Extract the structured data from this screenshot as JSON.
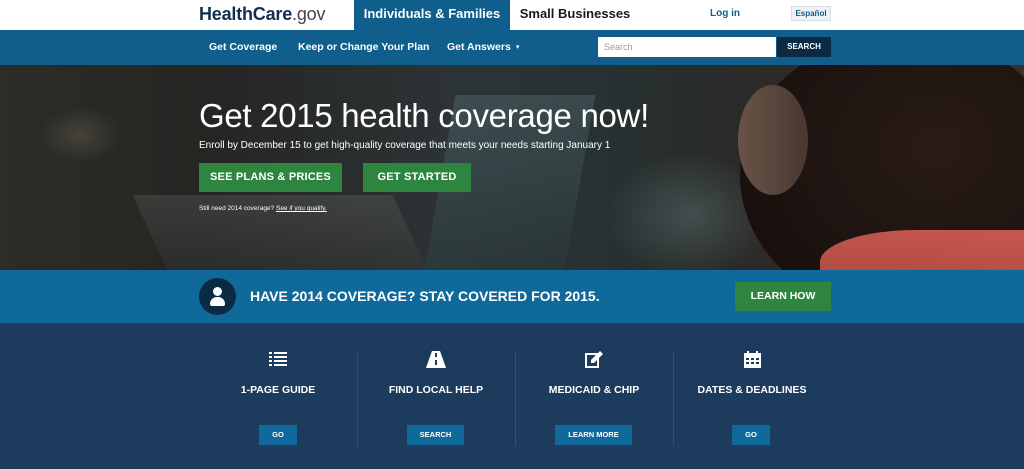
{
  "header": {
    "logo_brand": "HealthCare",
    "logo_suffix": ".gov",
    "tab_individuals": "Individuals & Families",
    "tab_small_business": "Small Businesses",
    "login": "Log in",
    "language": "Español"
  },
  "nav": {
    "items": [
      {
        "label": "Get Coverage"
      },
      {
        "label": "Keep or Change Your Plan"
      },
      {
        "label": "Get Answers",
        "caret": "▾"
      }
    ],
    "search_placeholder": "Search",
    "search_button": "SEARCH"
  },
  "hero": {
    "title": "Get 2015 health coverage now!",
    "subtitle": "Enroll by December 15 to get high-quality coverage that meets your needs starting January 1",
    "primary_button": "SEE PLANS & PRICES",
    "secondary_button": "GET STARTED",
    "note_text": "Still need 2014 coverage?",
    "note_link": "See if you qualify."
  },
  "band": {
    "icon": "person-icon",
    "text": "HAVE 2014 COVERAGE? STAY COVERED FOR 2015.",
    "button": "LEARN HOW"
  },
  "features": [
    {
      "icon": "list-icon",
      "title": "1-PAGE GUIDE",
      "button": "GO"
    },
    {
      "icon": "road-icon",
      "title": "FIND LOCAL HELP",
      "button": "SEARCH"
    },
    {
      "icon": "edit-icon",
      "title": "MEDICAID & CHIP",
      "button": "LEARN MORE"
    },
    {
      "icon": "calendar-icon",
      "title": "DATES & DEADLINES",
      "button": "GO"
    }
  ],
  "colors": {
    "primary_blue": "#0f5e8c",
    "band_blue": "#0f6a9b",
    "navy": "#1d3b5c",
    "green": "#2e8540"
  }
}
